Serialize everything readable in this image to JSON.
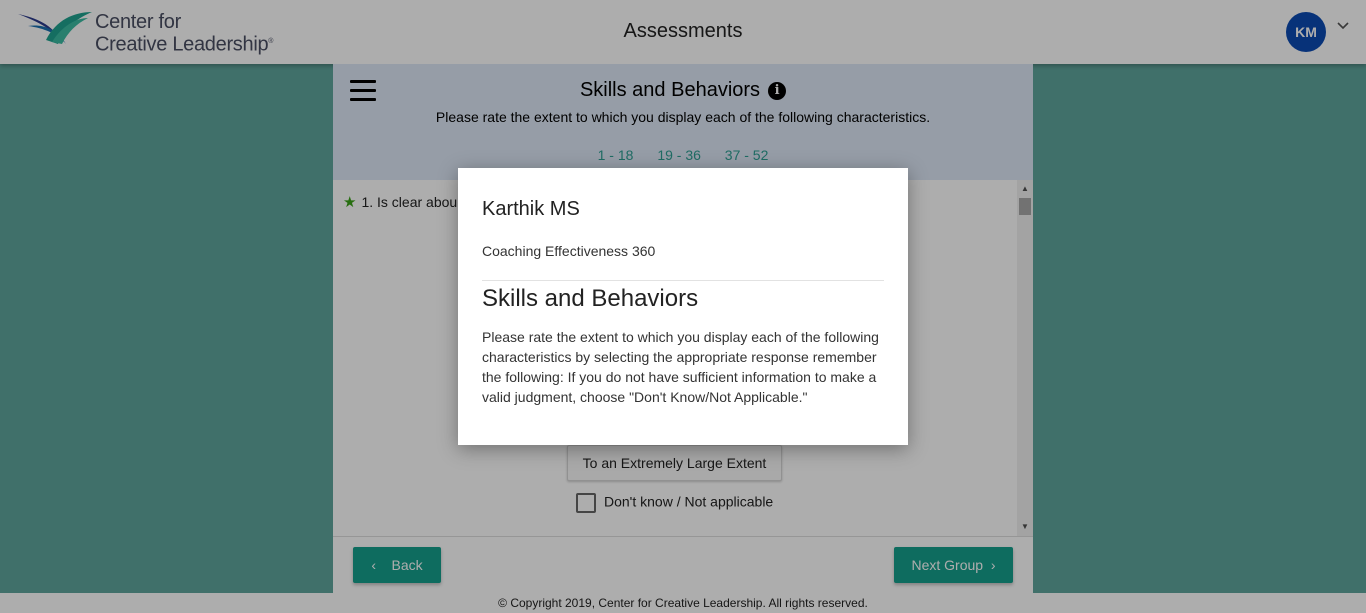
{
  "header": {
    "logo_line1": "Center for",
    "logo_line2": "Creative Leadership",
    "logo_mark": "®",
    "app_title": "Assessments",
    "avatar_initials": "KM"
  },
  "section": {
    "title": "Skills and Behaviors",
    "subtitle": "Please rate the extent to which you display each of the following characteristics.",
    "pages": [
      "1 - 18",
      "19 - 36",
      "37 - 52"
    ]
  },
  "question": {
    "text": "1. Is clear abou",
    "response_button": "To an Extremely Large Extent",
    "dont_know_label": "Don't know / Not applicable"
  },
  "footer": {
    "back_label": "Back",
    "next_label": "Next Group",
    "copyright": "© Copyright 2019, Center for Creative Leadership. All rights reserved."
  },
  "modal": {
    "name": "Karthik MS",
    "assessment": "Coaching Effectiveness 360",
    "title": "Skills and Behaviors",
    "body": "Please rate the extent to which you display each of the following characteristics by selecting the appropriate response remember the following: If you do not have sufficient information to make a valid judgment, choose \"Don't Know/Not Applicable.\""
  },
  "colors": {
    "background": "#5fa59c",
    "accent_green": "#16a08c",
    "avatar": "#0b4bb3",
    "header_band": "#dde8f6",
    "star": "#3aa319"
  },
  "icons": [
    "ccl-logo-icon",
    "chevron-down-icon",
    "hamburger-icon",
    "info-icon",
    "star-icon",
    "chevron-left-icon",
    "chevron-right-icon",
    "scroll-up-icon",
    "scroll-down-icon"
  ]
}
